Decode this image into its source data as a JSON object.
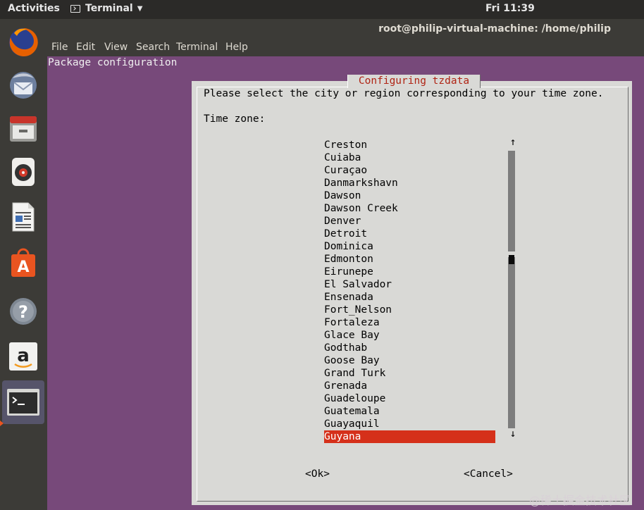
{
  "topbar": {
    "activities": "Activities",
    "app_menu": "Terminal",
    "clock": "Fri 11:39"
  },
  "dock": {
    "items": [
      {
        "name": "firefox",
        "icon": "firefox-icon"
      },
      {
        "name": "thunderbird",
        "icon": "thunderbird-icon"
      },
      {
        "name": "files",
        "icon": "files-icon"
      },
      {
        "name": "rhythmbox",
        "icon": "rhythmbox-icon"
      },
      {
        "name": "libreoffice-writer",
        "icon": "writer-icon"
      },
      {
        "name": "ubuntu-software",
        "icon": "software-center-icon"
      },
      {
        "name": "help",
        "icon": "help-icon"
      },
      {
        "name": "amazon",
        "icon": "amazon-icon"
      },
      {
        "name": "terminal",
        "icon": "terminal-icon"
      }
    ]
  },
  "window": {
    "title": "root@philip-virtual-machine: /home/philip",
    "menu": [
      "File",
      "Edit",
      "View",
      "Search",
      "Terminal",
      "Help"
    ]
  },
  "terminal": {
    "header": "Package configuration",
    "dialog": {
      "title": "Configuring tzdata",
      "prompt": "Please select the city or region corresponding to your time zone.",
      "list_label": "Time zone:",
      "timezones": [
        "Creston",
        "Cuiaba",
        "Curaçao",
        "Danmarkshavn",
        "Dawson",
        "Dawson Creek",
        "Denver",
        "Detroit",
        "Dominica",
        "Edmonton",
        "Eirunepe",
        "El Salvador",
        "Ensenada",
        "Fort_Nelson",
        "Fortaleza",
        "Glace Bay",
        "Godthab",
        "Goose Bay",
        "Grand Turk",
        "Grenada",
        "Guadeloupe",
        "Guatemala",
        "Guayaquil",
        "Guyana"
      ],
      "selected": "Guyana",
      "scroll_up": "↑",
      "scroll_down": "↓",
      "ok_button": "<Ok>",
      "cancel_button": "<Cancel>"
    }
  },
  "watermark": "@稀土掘金技术社区",
  "colors": {
    "desktop": "#77497a",
    "dialog_bg": "#d9d9d6",
    "title_red": "#b02414",
    "selection": "#d5301a"
  }
}
